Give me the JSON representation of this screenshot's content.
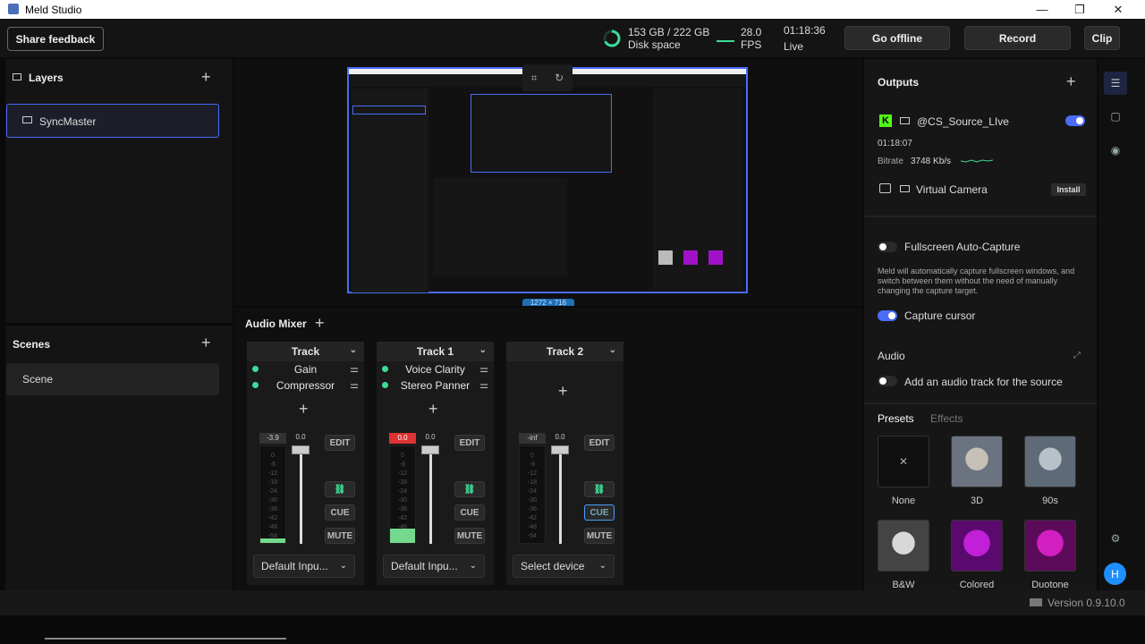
{
  "window": {
    "title": "Meld Studio"
  },
  "header": {
    "share_feedback": "Share feedback",
    "disk_value": "153 GB / 222 GB",
    "disk_label": "Disk space",
    "fps_value": "28.0",
    "fps_label": "FPS",
    "live_time": "01:18:36",
    "live_label": "Live",
    "go_offline": "Go offline",
    "record": "Record",
    "clip": "Clip"
  },
  "layers": {
    "title": "Layers",
    "items": [
      "SyncMaster"
    ]
  },
  "scenes": {
    "title": "Scenes",
    "items": [
      "Scene"
    ]
  },
  "preview": {
    "size_label": "1272 × 716"
  },
  "mixer": {
    "title": "Audio Mixer",
    "tracks": [
      {
        "name": "Track",
        "effects": [
          "Gain",
          "Compressor"
        ],
        "peak": "-3.9",
        "gain": "0.0",
        "device": "Default Inpu...",
        "level": 0.05
      },
      {
        "name": "Track 1",
        "effects": [
          "Voice Clarity",
          "Stereo Panner"
        ],
        "peak": "0.0",
        "gain": "0.0",
        "device": "Default Inpu...",
        "level": 0.15
      },
      {
        "name": "Track 2",
        "effects": [],
        "peak": "-inf",
        "gain": "0.0",
        "device": "Select device",
        "level": 0.0
      }
    ],
    "scale": [
      "0",
      "-6",
      "-12",
      "-18",
      "-24",
      "-30",
      "-36",
      "-42",
      "-48",
      "-54"
    ],
    "meter_level_text": "-54",
    "edit": "EDIT",
    "cue": "CUE",
    "mute": "MUTE"
  },
  "outputs": {
    "title": "Outputs",
    "stream": {
      "name": "@CS_Source_LIve",
      "time": "01:18:07",
      "bitrate_label": "Bitrate",
      "bitrate_value": "3748 Kb/s"
    },
    "virtual_camera": {
      "name": "Virtual Camera",
      "action": "Install"
    }
  },
  "properties": {
    "fullscreen_label": "Fullscreen Auto-Capture",
    "fullscreen_desc": "Meld will automatically capture fullscreen windows, and switch between them without the need of manually changing the capture target.",
    "capture_cursor": "Capture cursor",
    "audio_title": "Audio",
    "add_audio": "Add an audio track for the source",
    "tab_presets": "Presets",
    "tab_effects": "Effects",
    "presets": [
      "None",
      "3D",
      "90s",
      "B&W",
      "Colored",
      "Duotone"
    ]
  },
  "footer": {
    "version": "Version 0.9.10.0"
  },
  "avatar": {
    "initial": "H"
  },
  "colors": {
    "accent": "#4a6cf7",
    "live_green": "#3ddc97",
    "kick_green": "#53fc18"
  }
}
